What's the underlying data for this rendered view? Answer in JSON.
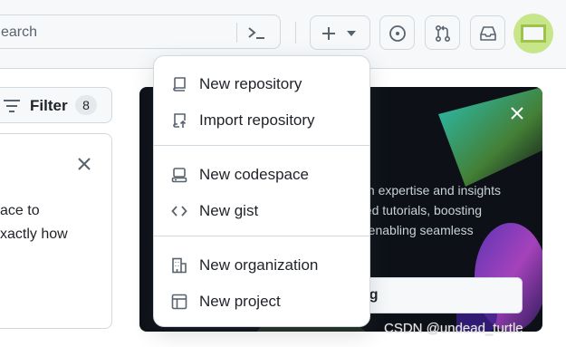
{
  "header": {
    "search_placeholder": "earch"
  },
  "filter": {
    "label": "Filter",
    "count": "8"
  },
  "left_card": {
    "lines": [
      "ace to",
      "xactly how"
    ]
  },
  "promo": {
    "lines": [
      "ain expertise and insights",
      "ded tutorials, boosting",
      "d enabling seamless"
    ],
    "button_label": "ng"
  },
  "menu": {
    "items": [
      {
        "label": "New repository",
        "icon": "repo-icon"
      },
      {
        "label": "Import repository",
        "icon": "repo-push-icon"
      },
      {
        "label": "New codespace",
        "icon": "codespaces-icon"
      },
      {
        "label": "New gist",
        "icon": "code-icon"
      },
      {
        "label": "New organization",
        "icon": "organization-icon"
      },
      {
        "label": "New project",
        "icon": "table-icon"
      }
    ]
  },
  "watermark": "CSDN @undead_turtle"
}
